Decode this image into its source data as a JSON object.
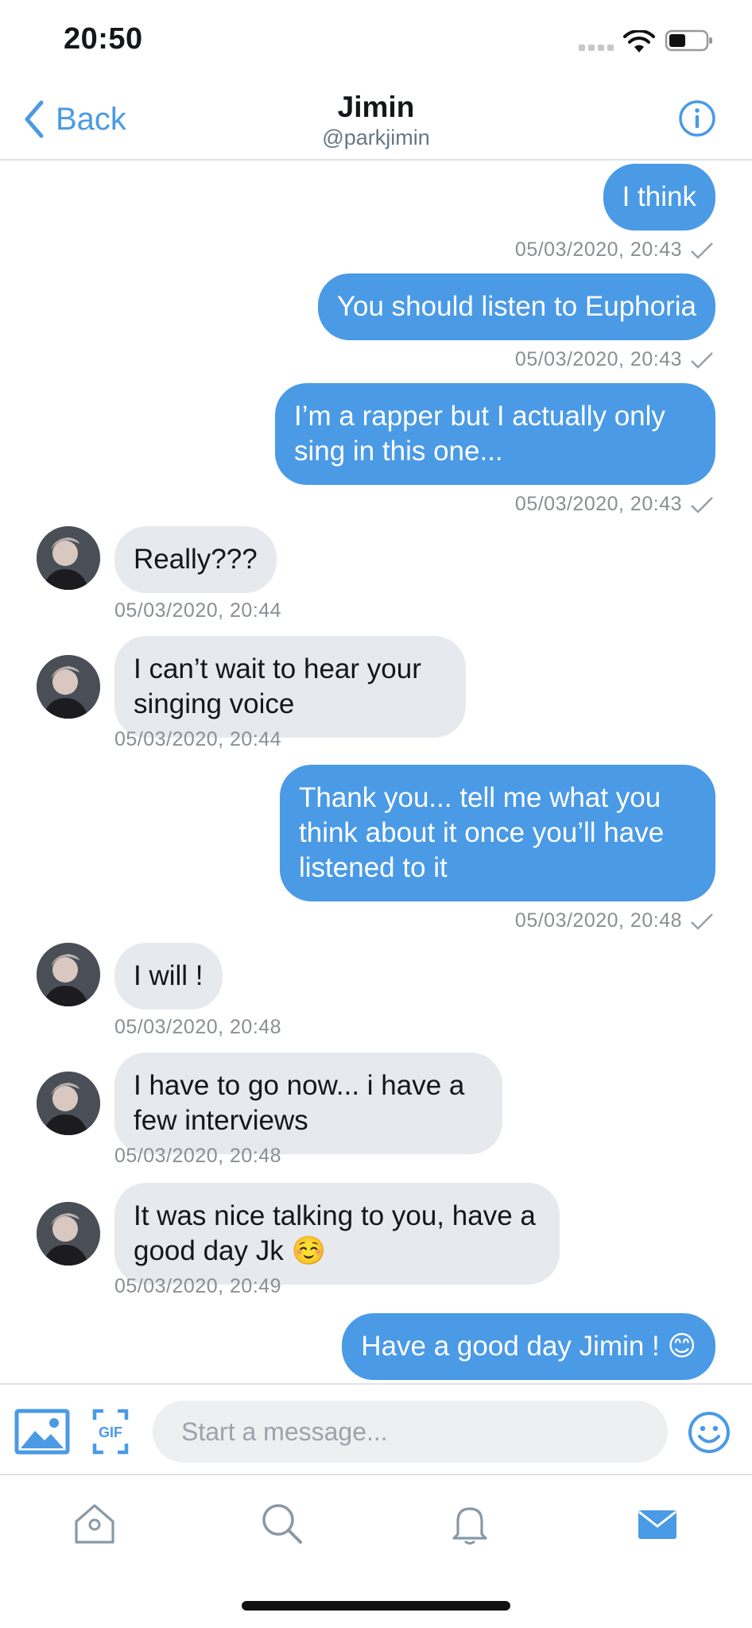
{
  "status_bar": {
    "time": "20:50"
  },
  "header": {
    "back_label": "Back",
    "title": "Jimin",
    "handle": "@parkjimin"
  },
  "messages": [
    {
      "dir": "out",
      "text": "I think",
      "timestamp": "05/03/2020, 20:43"
    },
    {
      "dir": "out",
      "text": "You should listen to Euphoria",
      "timestamp": "05/03/2020, 20:43"
    },
    {
      "dir": "out",
      "text": "I’m a rapper but I actually only sing in this one...",
      "timestamp": "05/03/2020, 20:43"
    },
    {
      "dir": "in",
      "text": "Really???",
      "timestamp": "05/03/2020, 20:44"
    },
    {
      "dir": "in",
      "text": "I can’t wait to hear your singing voice",
      "timestamp": "05/03/2020, 20:44"
    },
    {
      "dir": "out",
      "text": "Thank you... tell me what you think about it once you’ll have listened to it",
      "timestamp": "05/03/2020, 20:48"
    },
    {
      "dir": "in",
      "text": "I will !",
      "timestamp": "05/03/2020, 20:48"
    },
    {
      "dir": "in",
      "text": "I have to go now... i have a few interviews",
      "timestamp": "05/03/2020, 20:48"
    },
    {
      "dir": "in",
      "text": "It was nice talking to you, have a good day Jk ☺️",
      "timestamp": "05/03/2020, 20:49"
    },
    {
      "dir": "out",
      "text": "Have a good day Jimin ! 😊",
      "timestamp": ""
    }
  ],
  "composer": {
    "placeholder": "Start a message...",
    "gif_label": "GIF"
  },
  "tabs": [
    {
      "name": "home",
      "icon": "home-icon",
      "active": false
    },
    {
      "name": "search",
      "icon": "search-icon",
      "active": false
    },
    {
      "name": "notifications",
      "icon": "bell-icon",
      "active": false
    },
    {
      "name": "messages",
      "icon": "mail-icon",
      "active": true
    }
  ],
  "colors": {
    "accent": "#4a9ae6",
    "incoming_bubble": "#e6e9ed",
    "timestamp": "#8a8f94",
    "inactive_icon": "#8899a6"
  }
}
